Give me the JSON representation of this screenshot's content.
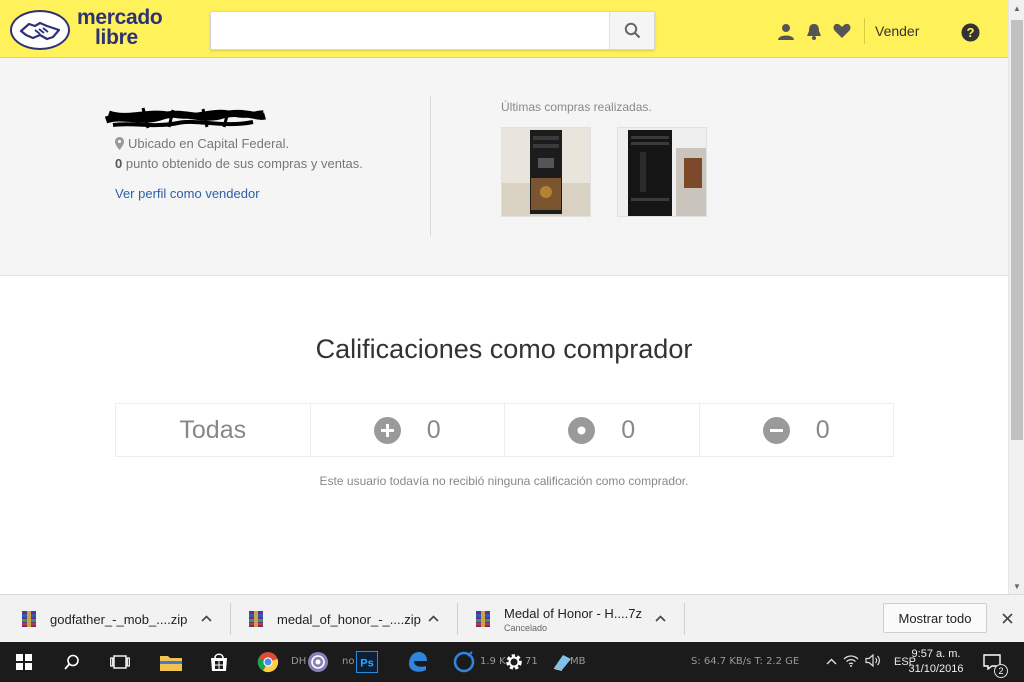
{
  "header": {
    "logo_line1": "mercado",
    "logo_line2": "libre",
    "search_placeholder": "",
    "sell_link": "Vender"
  },
  "profile": {
    "location": "Ubicado en Capital Federal.",
    "points_count": "0",
    "points_text": " punto obtenido de sus compras y ventas.",
    "seller_link": "Ver perfil como vendedor",
    "purchases_title": "Últimas compras realizadas."
  },
  "ratings": {
    "title": "Calificaciones como comprador",
    "filter_all": "Todas",
    "positive_count": "0",
    "neutral_count": "0",
    "negative_count": "0",
    "empty_message": "Este usuario todavía no recibió ninguna calificación como comprador."
  },
  "downloads": {
    "items": [
      {
        "name": "godfather_-_mob_....zip",
        "status": ""
      },
      {
        "name": "medal_of_honor_-_....zip",
        "status": ""
      },
      {
        "name": "Medal of Honor - H....7z",
        "status": "Cancelado"
      }
    ],
    "show_all": "Mostrar todo"
  },
  "taskbar": {
    "task_dh": "DH",
    "task_no": "no",
    "task_speed": "1.9 K",
    "task_size": "71",
    "task_mb": "MB",
    "net_stats": "S: 64.7 KB/s T: 2.2 GE",
    "language": "ESP",
    "time": "9:57 a. m.",
    "date": "31/10/2016",
    "notif_count": "2"
  },
  "colors": {
    "brand_yellow": "#fff159",
    "brand_navy": "#2d3277",
    "link_blue": "#2d5fa6"
  }
}
